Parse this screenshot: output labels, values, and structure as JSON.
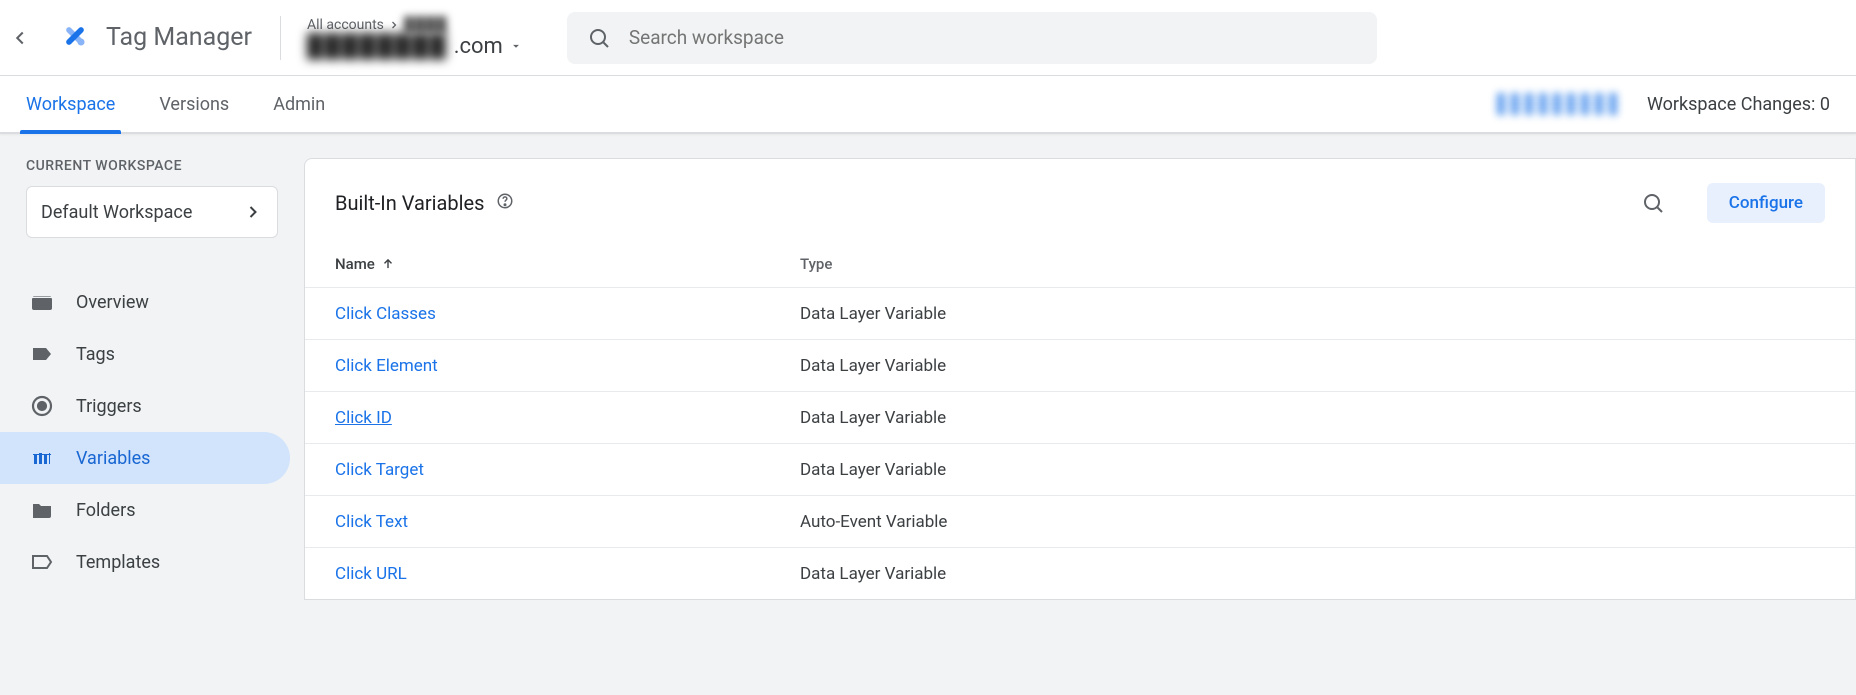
{
  "header": {
    "app_name": "Tag Manager",
    "breadcrumb_prefix": "All accounts",
    "account_blur": "████",
    "container_blur": "████████",
    "container_suffix": ".com",
    "search_placeholder": "Search workspace"
  },
  "tabs": {
    "workspace": "Workspace",
    "versions": "Versions",
    "admin": "Admin"
  },
  "workspace_changes_label": "Workspace Changes:",
  "workspace_changes_count": "0",
  "sidebar": {
    "section_title": "CURRENT WORKSPACE",
    "current_workspace": "Default Workspace",
    "items": [
      {
        "label": "Overview"
      },
      {
        "label": "Tags"
      },
      {
        "label": "Triggers"
      },
      {
        "label": "Variables"
      },
      {
        "label": "Folders"
      },
      {
        "label": "Templates"
      }
    ]
  },
  "panel": {
    "title": "Built-In Variables",
    "configure_label": "Configure",
    "columns": {
      "name": "Name",
      "type": "Type"
    },
    "rows": [
      {
        "name": "Click Classes",
        "type": "Data Layer Variable"
      },
      {
        "name": "Click Element",
        "type": "Data Layer Variable"
      },
      {
        "name": "Click ID",
        "type": "Data Layer Variable"
      },
      {
        "name": "Click Target",
        "type": "Data Layer Variable"
      },
      {
        "name": "Click Text",
        "type": "Auto-Event Variable"
      },
      {
        "name": "Click URL",
        "type": "Data Layer Variable"
      }
    ]
  }
}
